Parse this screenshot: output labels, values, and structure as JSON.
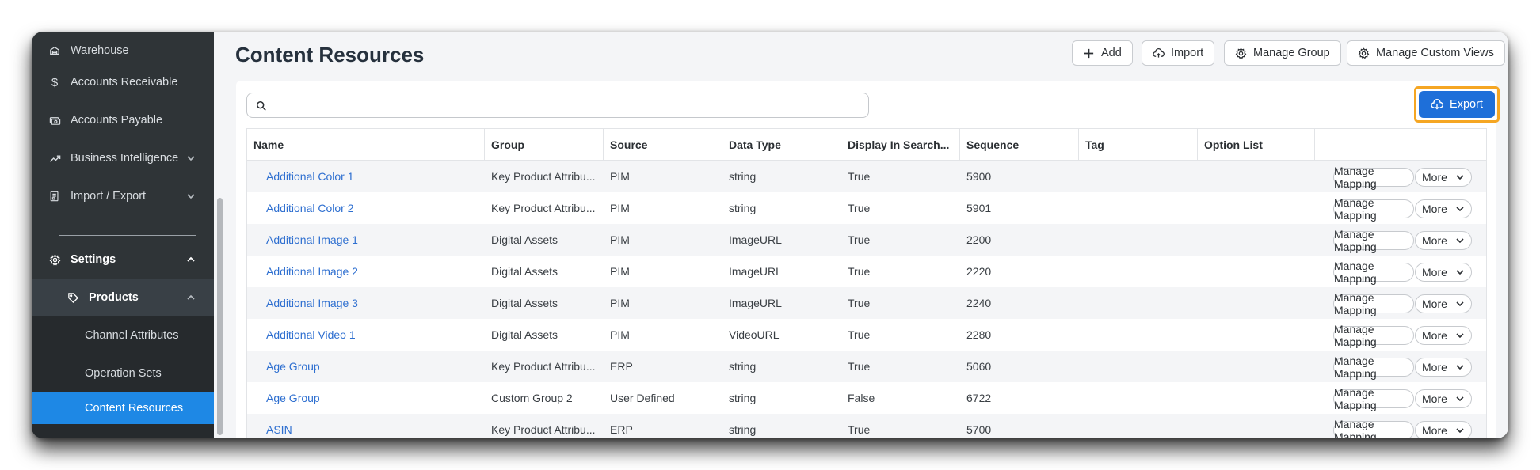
{
  "sidebar": {
    "items": [
      {
        "label": "Warehouse",
        "icon": "warehouse-icon"
      },
      {
        "label": "Accounts Receivable",
        "icon": "dollar-icon"
      },
      {
        "label": "Accounts Payable",
        "icon": "money-icon"
      },
      {
        "label": "Business Intelligence",
        "icon": "trend-icon"
      },
      {
        "label": "Import / Export",
        "icon": "file-icon"
      },
      {
        "label": "Settings",
        "icon": "gear-icon"
      },
      {
        "label": "Products",
        "icon": "tag-icon"
      },
      {
        "label": "Channel Attributes"
      },
      {
        "label": "Operation Sets"
      },
      {
        "label": "Content Resources"
      }
    ]
  },
  "page": {
    "title": "Content Resources"
  },
  "toolbar": {
    "add_label": "Add",
    "import_label": "Import",
    "manage_group_label": "Manage Group",
    "manage_views_label": "Manage Custom Views",
    "export_label": "Export"
  },
  "search": {
    "value": "",
    "placeholder": ""
  },
  "table": {
    "headers": [
      "Name",
      "Group",
      "Source",
      "Data Type",
      "Display In Search...",
      "Sequence",
      "Tag",
      "Option List"
    ],
    "manage_mapping_label": "Manage Mapping",
    "more_label": "More",
    "rows": [
      {
        "name": "Additional Color 1",
        "group": "Key Product Attribu...",
        "source": "PIM",
        "data_type": "string",
        "display": "True",
        "sequence": "5900",
        "tag": "",
        "option_list": ""
      },
      {
        "name": "Additional Color 2",
        "group": "Key Product Attribu...",
        "source": "PIM",
        "data_type": "string",
        "display": "True",
        "sequence": "5901",
        "tag": "",
        "option_list": ""
      },
      {
        "name": "Additional Image 1",
        "group": "Digital Assets",
        "source": "PIM",
        "data_type": "ImageURL",
        "display": "True",
        "sequence": "2200",
        "tag": "",
        "option_list": ""
      },
      {
        "name": "Additional Image 2",
        "group": "Digital Assets",
        "source": "PIM",
        "data_type": "ImageURL",
        "display": "True",
        "sequence": "2220",
        "tag": "",
        "option_list": ""
      },
      {
        "name": "Additional Image 3",
        "group": "Digital Assets",
        "source": "PIM",
        "data_type": "ImageURL",
        "display": "True",
        "sequence": "2240",
        "tag": "",
        "option_list": ""
      },
      {
        "name": "Additional Video 1",
        "group": "Digital Assets",
        "source": "PIM",
        "data_type": "VideoURL",
        "display": "True",
        "sequence": "2280",
        "tag": "",
        "option_list": ""
      },
      {
        "name": "Age Group",
        "group": "Key Product Attribu...",
        "source": "ERP",
        "data_type": "string",
        "display": "True",
        "sequence": "5060",
        "tag": "",
        "option_list": ""
      },
      {
        "name": "Age Group",
        "group": "Custom Group 2",
        "source": "User Defined",
        "data_type": "string",
        "display": "False",
        "sequence": "6722",
        "tag": "",
        "option_list": ""
      },
      {
        "name": "ASIN",
        "group": "Key Product Attribu...",
        "source": "ERP",
        "data_type": "string",
        "display": "True",
        "sequence": "5700",
        "tag": "",
        "option_list": ""
      }
    ]
  },
  "colors": {
    "sidebar_bg": "#2f3437",
    "active_item": "#1e88e5",
    "export_button": "#1e6fd9",
    "highlight_border": "#f5a623",
    "link": "#2e6fd0"
  }
}
